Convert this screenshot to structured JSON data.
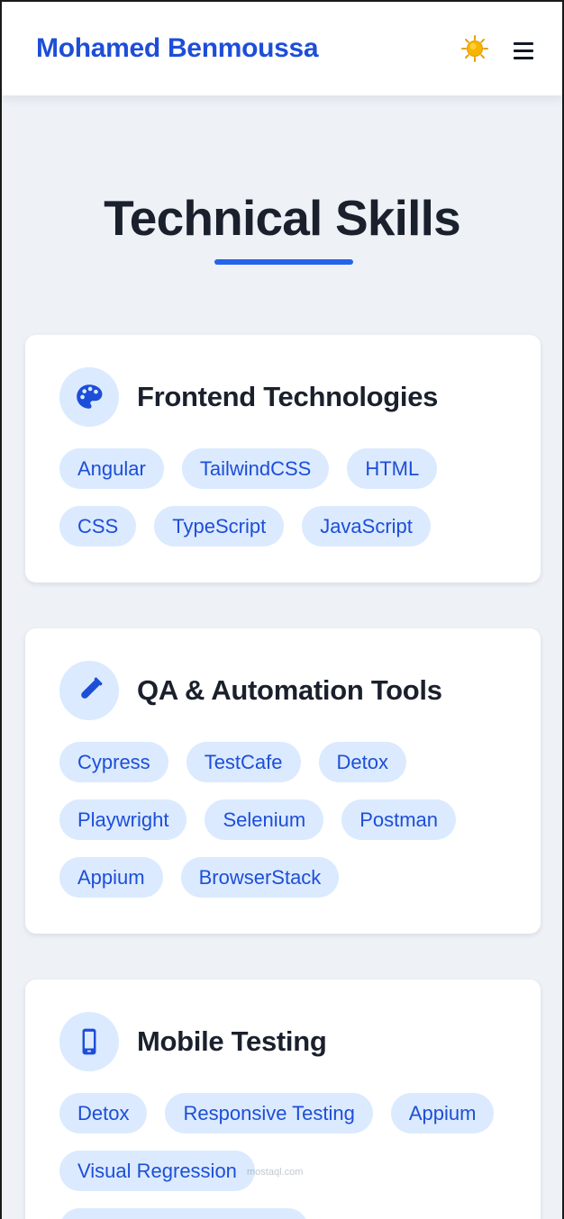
{
  "header": {
    "brand": "Mohamed Benmoussa",
    "theme_icon": "sun-icon",
    "menu_icon": "hamburger-menu-icon"
  },
  "page": {
    "title": "Technical Skills",
    "accent_color": "#2563eb"
  },
  "cards": [
    {
      "title": "Frontend Technologies",
      "icon": "palette-icon",
      "tags": [
        "Angular",
        "TailwindCSS",
        "HTML",
        "CSS",
        "TypeScript",
        "JavaScript"
      ]
    },
    {
      "title": "QA & Automation Tools",
      "icon": "test-tube-icon",
      "tags": [
        "Cypress",
        "TestCafe",
        "Detox",
        "Playwright",
        "Selenium",
        "Postman",
        "Appium",
        "BrowserStack"
      ]
    },
    {
      "title": "Mobile Testing",
      "icon": "mobile-phone-icon",
      "tags": [
        "Detox",
        "Responsive Testing",
        "Appium",
        "Visual Regression"
      ]
    }
  ],
  "watermark": {
    "line1": "mostaql.com"
  }
}
